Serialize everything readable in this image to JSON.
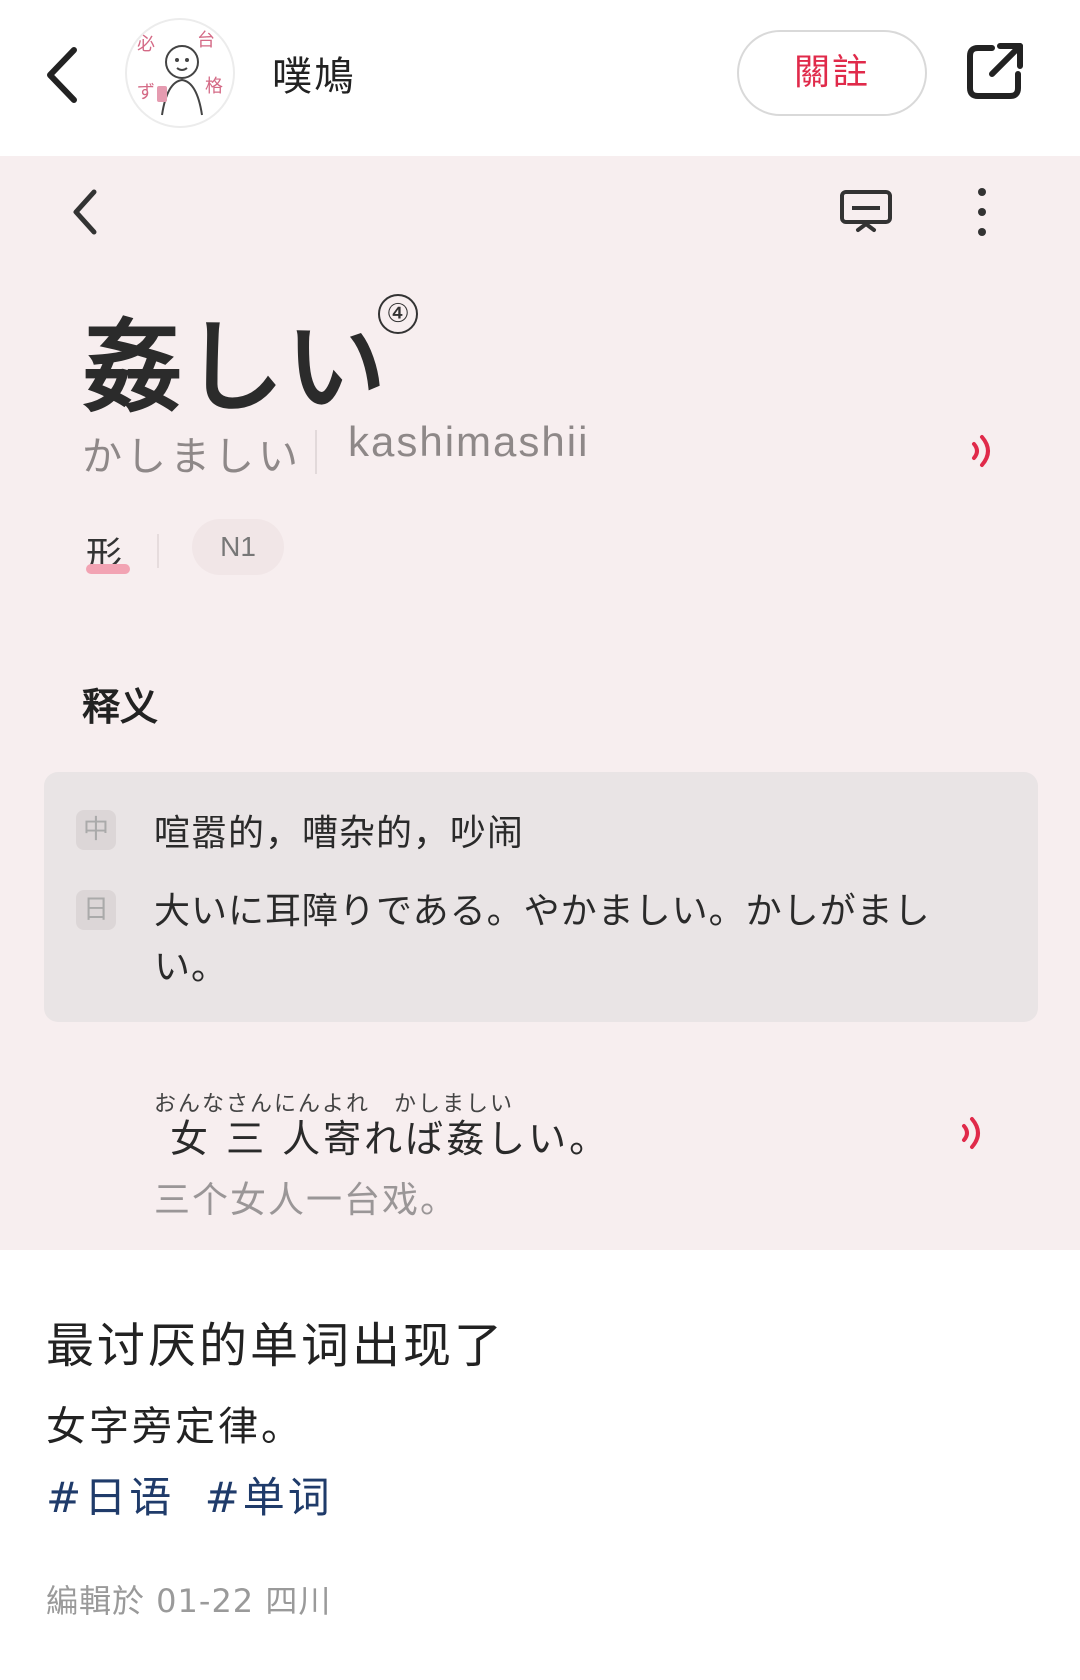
{
  "header": {
    "author_name": "噗鳩",
    "follow_label": "關註",
    "avatar_text": "必 台 格 ず"
  },
  "dictionary": {
    "word": "姦しい",
    "accent": "④",
    "kana": "かしましい",
    "romaji": "kashimashii",
    "part_of_speech": "形",
    "level": "N1",
    "section_title": "释义",
    "zh_badge": "中",
    "ja_badge": "日",
    "definition_zh": "喧嚣的，嘈杂的，吵闹",
    "definition_ja": "大いに耳障りである。やかましい。かしがましい。",
    "example_ruby": "おんなさんにんよれ　かしましい",
    "example": "女 三 人寄れば姦しい。",
    "example_translation": "三个女人一台戏。"
  },
  "post": {
    "title": "最讨厌的单词出现了",
    "body": "女字旁定律。",
    "tags": [
      "#日语",
      "#单词"
    ],
    "meta": "編輯於 01-22 四川"
  },
  "colors": {
    "accent_red": "#e02a4a",
    "pink_bg": "#f7eeef",
    "tag_blue": "#1f3b6a"
  }
}
